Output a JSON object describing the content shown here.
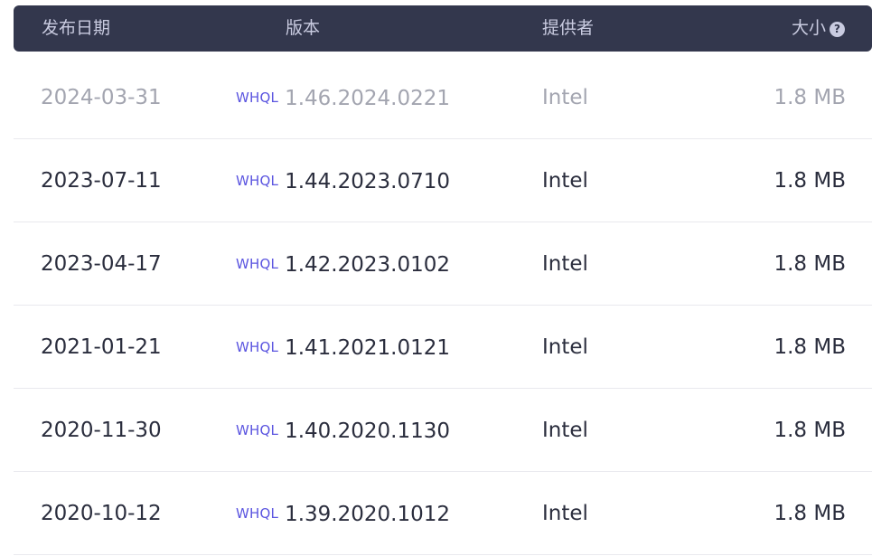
{
  "header": {
    "date": "发布日期",
    "version": "版本",
    "provider": "提供者",
    "size": "大小",
    "size_help_glyph": "?"
  },
  "rows": [
    {
      "date": "2024-03-31",
      "badge": "WHQL",
      "version": "1.46.2024.0221",
      "provider": "Intel",
      "size": "1.8 MB"
    },
    {
      "date": "2023-07-11",
      "badge": "WHQL",
      "version": "1.44.2023.0710",
      "provider": "Intel",
      "size": "1.8 MB"
    },
    {
      "date": "2023-04-17",
      "badge": "WHQL",
      "version": "1.42.2023.0102",
      "provider": "Intel",
      "size": "1.8 MB"
    },
    {
      "date": "2021-01-21",
      "badge": "WHQL",
      "version": "1.41.2021.0121",
      "provider": "Intel",
      "size": "1.8 MB"
    },
    {
      "date": "2020-11-30",
      "badge": "WHQL",
      "version": "1.40.2020.1130",
      "provider": "Intel",
      "size": "1.8 MB"
    },
    {
      "date": "2020-10-12",
      "badge": "WHQL",
      "version": "1.39.2020.1012",
      "provider": "Intel",
      "size": "1.8 MB"
    }
  ],
  "colors": {
    "header_bg": "#33374d",
    "header_text": "#c9cbe0",
    "badge": "#5b55e0",
    "muted_text": "#a3a5b0",
    "text": "#2a2d3d"
  }
}
